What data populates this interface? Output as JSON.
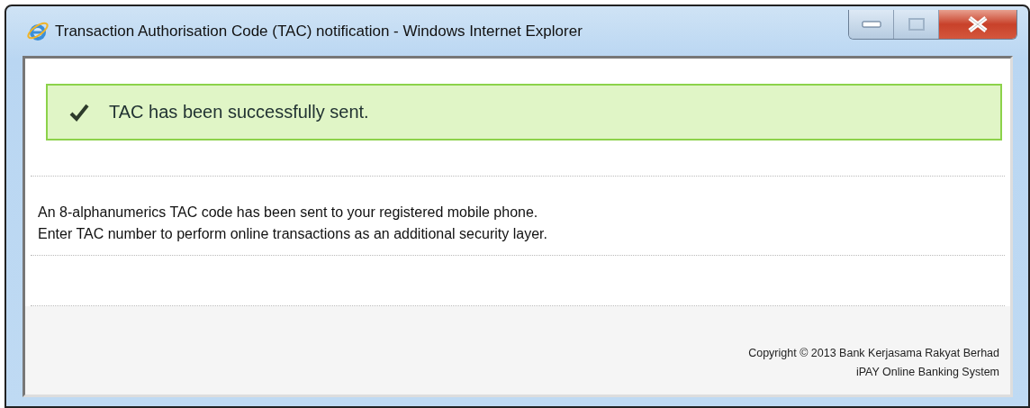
{
  "window": {
    "title": "Transaction Authorisation Code (TAC) notification - Windows Internet Explorer"
  },
  "alert": {
    "kind": "success",
    "message": "TAC has been successfully sent."
  },
  "body": [
    "An 8-alphanumerics TAC code has been sent to your registered mobile phone.",
    "Enter TAC number to perform online transactions as an additional security layer."
  ],
  "footer": [
    "Copyright © 2013 Bank Kerjasama Rakyat Berhad",
    "iPAY Online Banking System"
  ]
}
